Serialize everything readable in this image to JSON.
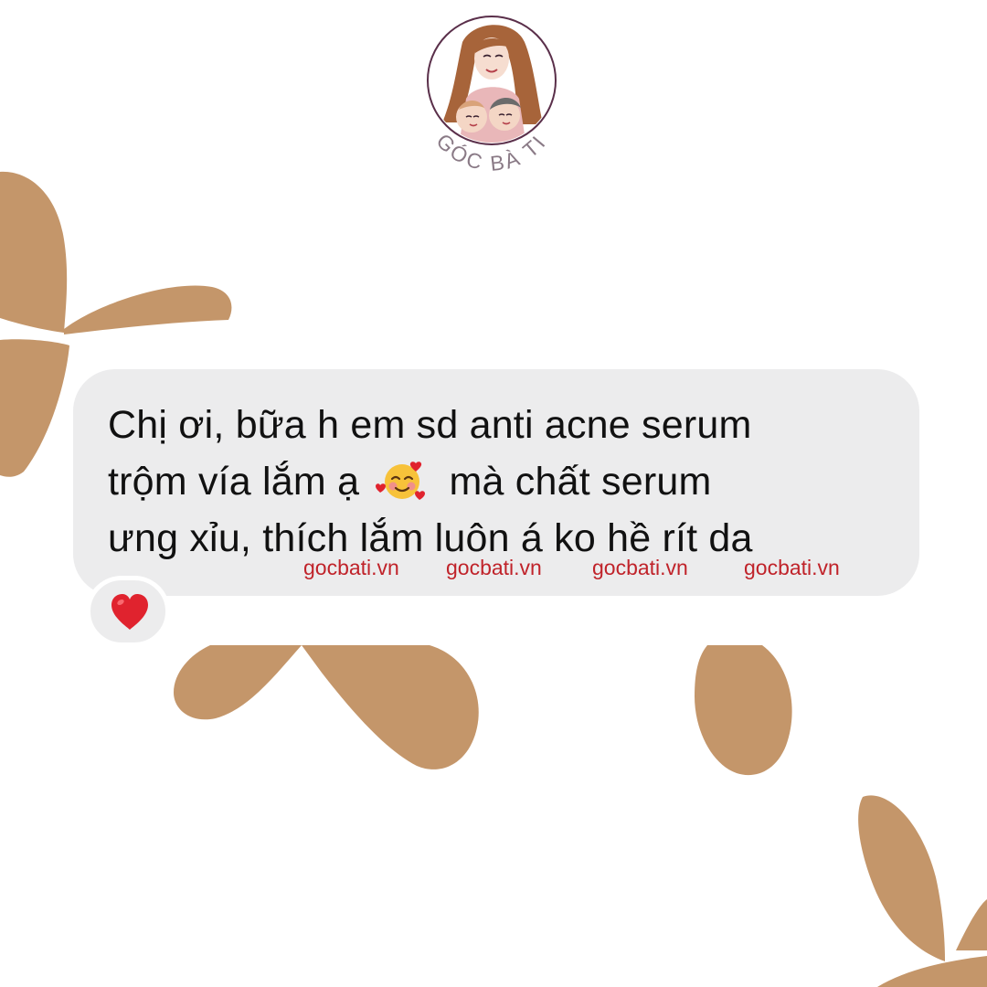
{
  "brand": {
    "name": "GÓC BÀ TI",
    "logo_icon": "mother-with-babies-portrait-icon"
  },
  "message": {
    "line1": "Chị ơi, bữa h em sd anti acne serum",
    "line2_before": "trộm vía lắm ạ",
    "emoji": "smiling-face-with-hearts-icon",
    "line2_after": "mà chất serum",
    "line3": "ưng xỉu, thích lắm luôn á ko hề rít da"
  },
  "watermarks": [
    "gocbati.vn",
    "gocbati.vn",
    "gocbati.vn",
    "gocbati.vn"
  ],
  "reaction": {
    "icon": "red-heart-icon"
  },
  "colors": {
    "background": "#ffffff",
    "bubble": "#ececed",
    "text": "#111111",
    "watermark": "#c0232a",
    "decoration": "#c4966a",
    "heart": "#e0232e",
    "logo_ring": "#5a2f4a"
  }
}
